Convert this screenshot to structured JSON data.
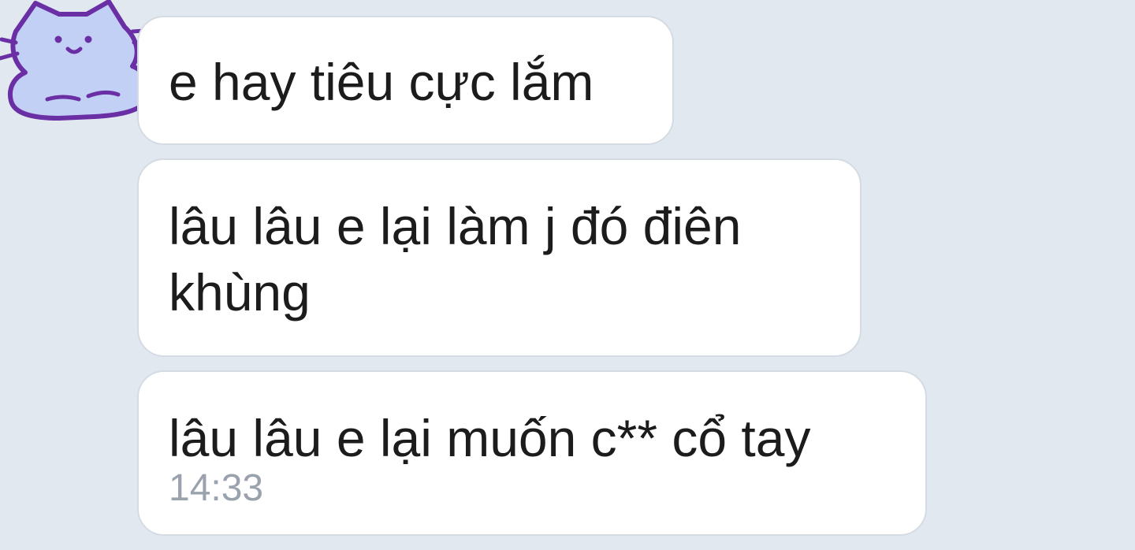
{
  "chat": {
    "messages": [
      {
        "text": "e hay tiêu cực lắm"
      },
      {
        "text": "lâu lâu e lại làm j đó điên\nkhùng"
      },
      {
        "text": "lâu lâu e lại muốn c** cổ tay",
        "time": "14:33"
      }
    ],
    "avatar": {
      "icon": "cat-avatar-icon",
      "fill_color": "#c3d0f5",
      "stroke_color": "#6a2fa4"
    }
  }
}
